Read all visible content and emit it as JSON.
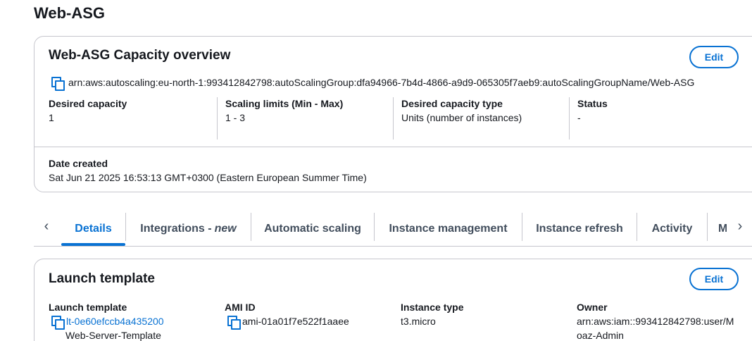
{
  "page": {
    "title": "Web-ASG"
  },
  "overview": {
    "title": "Web-ASG Capacity overview",
    "edit_label": "Edit",
    "arn": "arn:aws:autoscaling:eu-north-1:993412842798:autoScalingGroup:dfa94966-7b4d-4866-a9d9-065305f7aeb9:autoScalingGroupName/Web-ASG",
    "fields": [
      {
        "label": "Desired capacity",
        "value": "1"
      },
      {
        "label": "Scaling limits (Min - Max)",
        "value": "1 - 3"
      },
      {
        "label": "Desired capacity type",
        "value": "Units (number of instances)"
      },
      {
        "label": "Status",
        "value": "-"
      }
    ],
    "date_created": {
      "label": "Date created",
      "value": "Sat Jun 21 2025 16:53:13 GMT+0300 (Eastern European Summer Time)"
    }
  },
  "tabs": {
    "items": [
      {
        "label": "Details"
      },
      {
        "label": "Integrations -",
        "suffix": "new"
      },
      {
        "label": "Automatic scaling"
      },
      {
        "label": "Instance management"
      },
      {
        "label": "Instance refresh"
      },
      {
        "label": "Activity"
      },
      {
        "label": "M"
      }
    ],
    "active_index": 0
  },
  "launch_template": {
    "title": "Launch template",
    "edit_label": "Edit",
    "fields": [
      {
        "label": "Launch template",
        "value": "lt-0e60efccb4a435200",
        "subvalue": "Web-Server-Template"
      },
      {
        "label": "AMI ID",
        "value": "ami-01a01f7e522f1aaee"
      },
      {
        "label": "Instance type",
        "value": "t3.micro"
      },
      {
        "label": "Owner",
        "value": "arn:aws:iam::993412842798:user/M",
        "value_line2": "oaz-Admin"
      }
    ]
  },
  "colors": {
    "accent": "#0972d3",
    "text": "#16191f",
    "border": "#c6c6cd",
    "tab_text": "#414d5c"
  },
  "icons": {
    "copy": "copy-icon",
    "tab_prev": "chevron-left-icon",
    "tab_next": "chevron-right-icon"
  }
}
